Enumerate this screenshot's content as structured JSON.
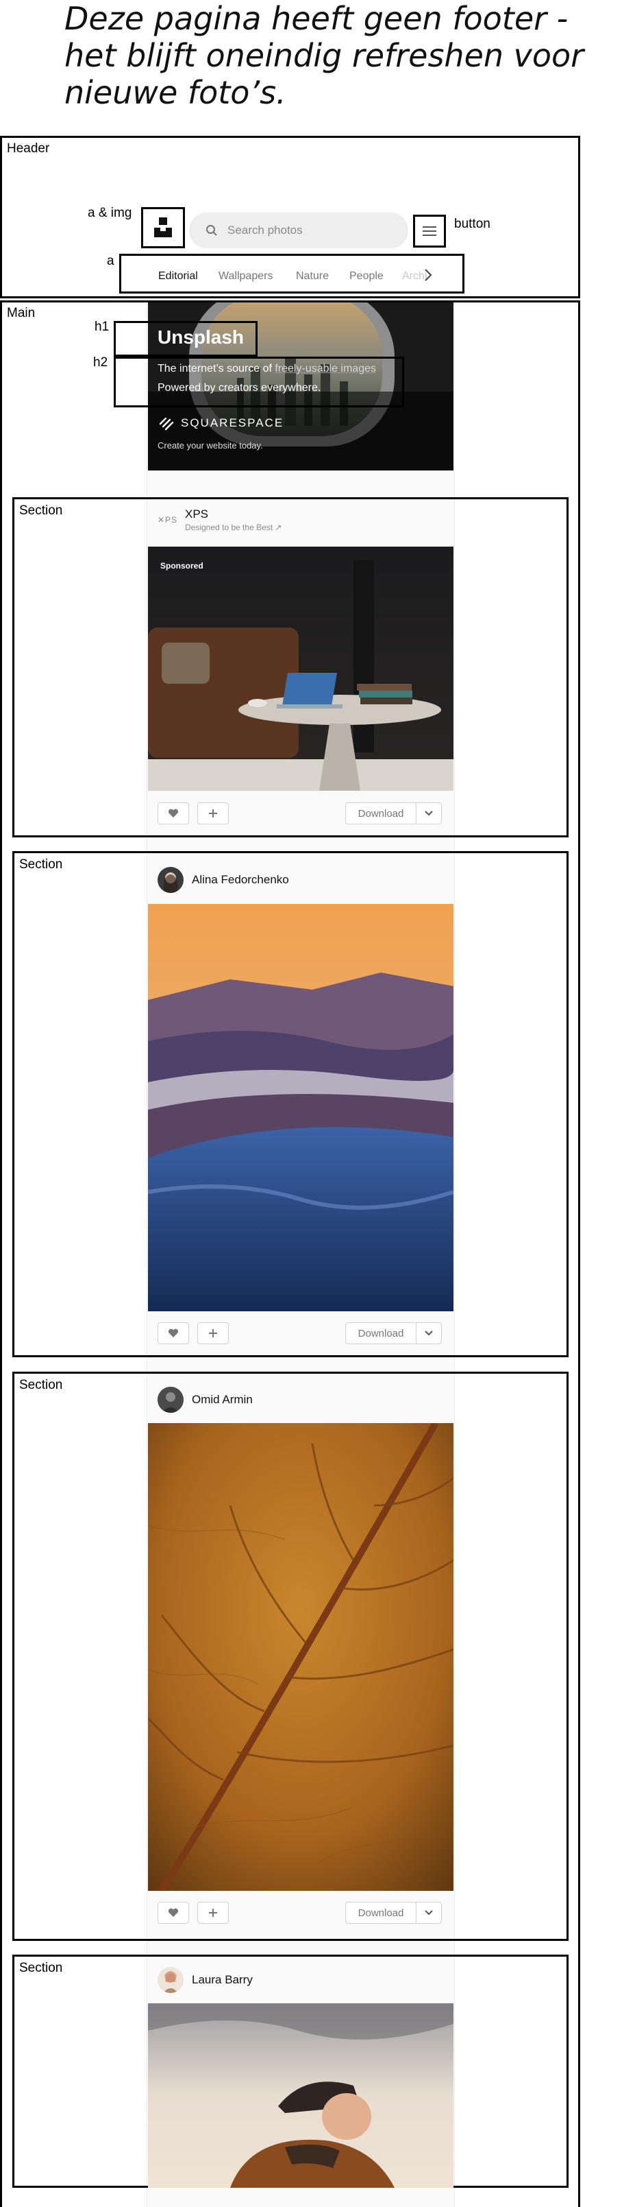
{
  "page_title": "Deze pagina heeft geen footer - het blijft oneindig refreshen voor nieuwe foto’s.",
  "annotations": {
    "header": "Header",
    "logo": "a & img",
    "button": "button",
    "tabs_link": "a",
    "main": "Main",
    "h1": "h1",
    "h2": "h2",
    "section": "Section"
  },
  "header": {
    "search_placeholder": "Search photos",
    "tabs": [
      "Editorial",
      "Wallpapers",
      "Nature",
      "People",
      "Archi"
    ]
  },
  "hero": {
    "title": "Unsplash",
    "subtitle_line1_prefix": "The internet’s source of ",
    "subtitle_link": "freely-usable images",
    "subtitle_line2": "Powered by creators everywhere.",
    "sponsor_brand": "SQUARESPACE",
    "sponsor_tagline": "Create your website today."
  },
  "cards": [
    {
      "author": "XPS",
      "subtitle": "Designed to be the Best ↗",
      "badge": "Sponsored",
      "download": "Download"
    },
    {
      "author": "Alina Fedorchenko",
      "download": "Download"
    },
    {
      "author": "Omid Armin",
      "download": "Download"
    },
    {
      "author": "Laura Barry"
    }
  ],
  "colors": {
    "accent_border": "#000000",
    "search_bg": "#eeeeee",
    "muted_text": "#767676"
  }
}
